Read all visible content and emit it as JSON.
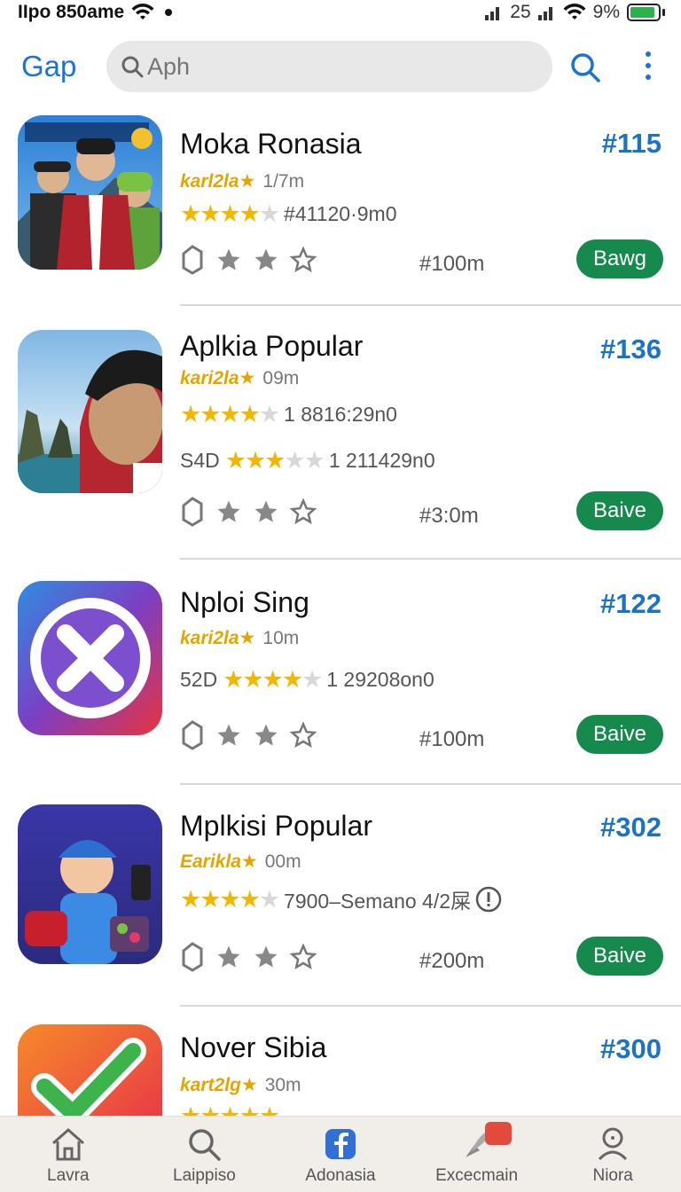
{
  "status_bar": {
    "left_text": "IIpo 850ame",
    "signal_text": "25",
    "battery_text": "9%",
    "battery_level": 0.9
  },
  "header": {
    "brand": "Gap",
    "search_placeholder": "Aph"
  },
  "apps": [
    {
      "title": "Moka Ronasia",
      "rank": "#115",
      "sub_tag": "karl2la★",
      "sub_value": "1/7m",
      "rating_lines": [
        {
          "prefix": "",
          "stars": 4.5,
          "text": "#41120·9m0"
        }
      ],
      "size": "#100m",
      "button": "Bawg"
    },
    {
      "title": "Aplkia Popular",
      "rank": "#136",
      "sub_tag": "kari2la★",
      "sub_value": "09m",
      "rating_lines": [
        {
          "prefix": "",
          "stars": 4.5,
          "text": "1 8816:29n0"
        },
        {
          "prefix": "S4D",
          "stars": 3.5,
          "text": "1 211429n0"
        }
      ],
      "size": "#3:0m",
      "button": "Baive"
    },
    {
      "title": "Nploi Sing",
      "rank": "#122",
      "sub_tag": "kari2la★",
      "sub_value": "10m",
      "rating_lines": [
        {
          "prefix": "52D",
          "stars": 4,
          "text": "1 29208on0"
        }
      ],
      "size": "#100m",
      "button": "Baive"
    },
    {
      "title": "Mplkisi Popular",
      "rank": "#302",
      "sub_tag": "Earikla★",
      "sub_value": "00m",
      "rating_lines": [
        {
          "prefix": "",
          "stars": 4.5,
          "text": "7900–Semano 4/2屎"
        }
      ],
      "size": "#200m",
      "button": "Baive"
    },
    {
      "title": "Nover Sibia",
      "rank": "#300",
      "sub_tag": "kart2lg★",
      "sub_value": "30m",
      "rating_lines": [],
      "size": "",
      "button": ""
    }
  ],
  "bottom_nav": [
    {
      "label": "Lavra",
      "icon": "home-icon"
    },
    {
      "label": "Laippiso",
      "icon": "search-icon"
    },
    {
      "label": "Adonasia",
      "icon": "facebook-icon"
    },
    {
      "label": "Excecmain",
      "icon": "rocket-icon"
    },
    {
      "label": "Niora",
      "icon": "profile-icon"
    }
  ],
  "colors": {
    "accent": "#1a73d9",
    "button": "#168a4c",
    "star": "#f2b705"
  }
}
